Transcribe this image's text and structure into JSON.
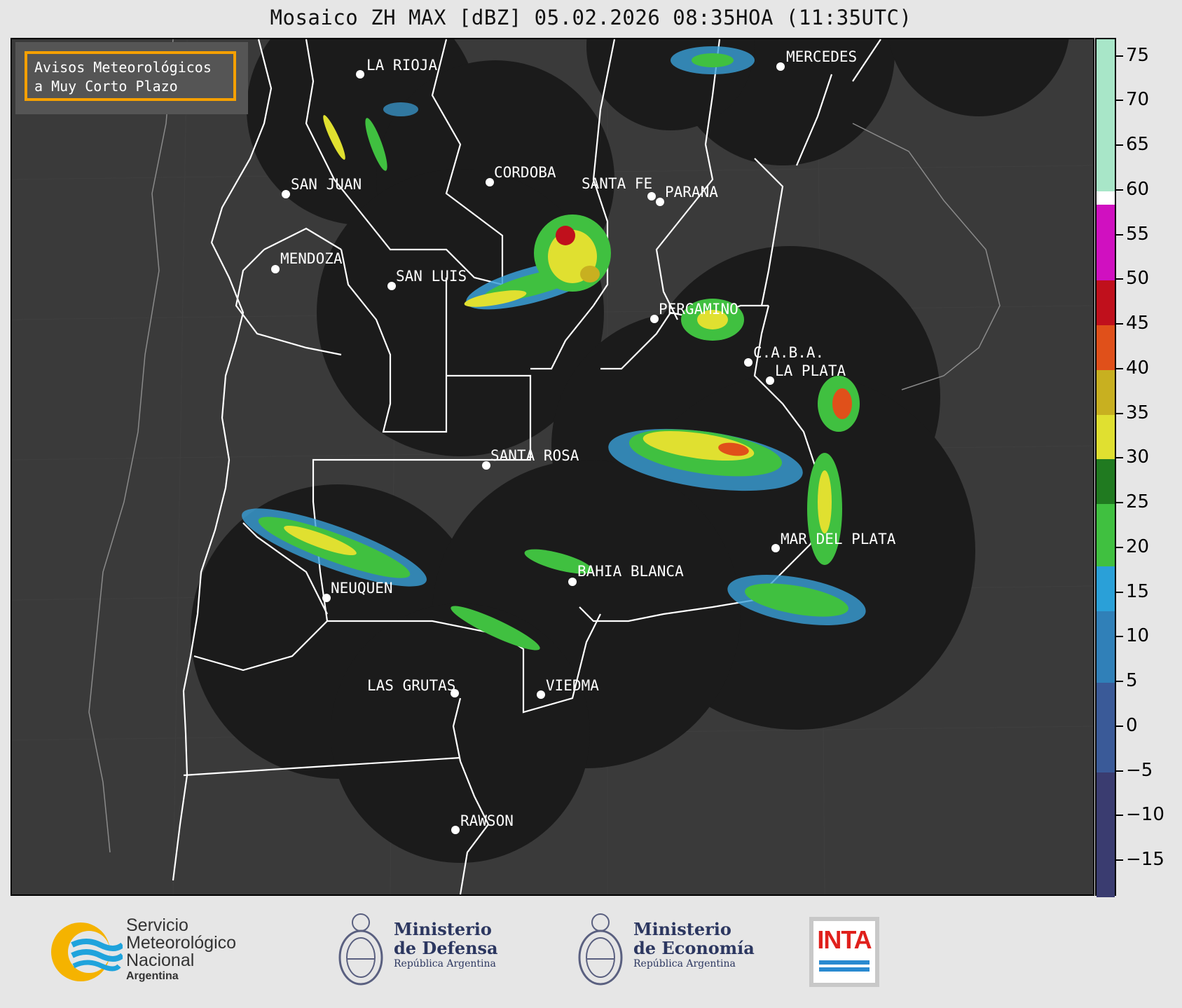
{
  "title": "Mosaico ZH MAX [dBZ] 05.02.2026 08:35HOA (11:35UTC)",
  "avisos": {
    "line1": "Avisos Meteorológicos",
    "line2": "a Muy Corto Plazo"
  },
  "cities": [
    {
      "name": "LA RIOJA"
    },
    {
      "name": "MERCEDES"
    },
    {
      "name": "SAN JUAN"
    },
    {
      "name": "CORDOBA"
    },
    {
      "name": "SANTA FE"
    },
    {
      "name": "PARANA"
    },
    {
      "name": "MENDOZA"
    },
    {
      "name": "SAN LUIS"
    },
    {
      "name": "PERGAMINO"
    },
    {
      "name": "C.A.B.A."
    },
    {
      "name": "LA PLATA"
    },
    {
      "name": "SANTA ROSA"
    },
    {
      "name": "MAR DEL PLATA"
    },
    {
      "name": "BAHIA BLANCA"
    },
    {
      "name": "NEUQUEN"
    },
    {
      "name": "LAS GRUTAS"
    },
    {
      "name": "VIEDMA"
    },
    {
      "name": "RAWSON"
    }
  ],
  "colorbar": {
    "min": -19,
    "max": 77,
    "ticks": [
      "75",
      "70",
      "65",
      "60",
      "55",
      "50",
      "45",
      "40",
      "35",
      "30",
      "25",
      "20",
      "15",
      "10",
      "5",
      "0",
      "−5",
      "−10",
      "−15"
    ],
    "stops": [
      {
        "from": 60,
        "to": 77,
        "color": "#a8e6c8"
      },
      {
        "from": 58.5,
        "to": 60,
        "color": "#ffffff"
      },
      {
        "from": 50,
        "to": 58.5,
        "color": "#d010c0"
      },
      {
        "from": 45,
        "to": 50,
        "color": "#c0101c"
      },
      {
        "from": 40,
        "to": 45,
        "color": "#e0501a"
      },
      {
        "from": 35,
        "to": 40,
        "color": "#c8b020"
      },
      {
        "from": 30,
        "to": 35,
        "color": "#e0e030"
      },
      {
        "from": 25,
        "to": 30,
        "color": "#207a20"
      },
      {
        "from": 18,
        "to": 25,
        "color": "#40c040"
      },
      {
        "from": 13,
        "to": 18,
        "color": "#2aa0d8"
      },
      {
        "from": 5,
        "to": 13,
        "color": "#3080b8"
      },
      {
        "from": -5,
        "to": 5,
        "color": "#3a5a98"
      },
      {
        "from": -19,
        "to": -5,
        "color": "#3a3c70"
      }
    ]
  },
  "footer": {
    "smn": {
      "line1": "Servicio",
      "line2": "Meteorológico",
      "line3": "Nacional",
      "line4": "Argentina"
    },
    "defensa": {
      "line1": "Ministerio",
      "line2": "de Defensa",
      "line3": "República Argentina"
    },
    "economia": {
      "line1": "Ministerio",
      "line2": "de Economía",
      "line3": "República Argentina"
    },
    "inta": {
      "text": "INTA"
    }
  },
  "colors": {
    "radar_disk": "#1b1b1b",
    "land": "#3a3a3a",
    "border": "#ffffff",
    "accent": "#f5a000"
  }
}
